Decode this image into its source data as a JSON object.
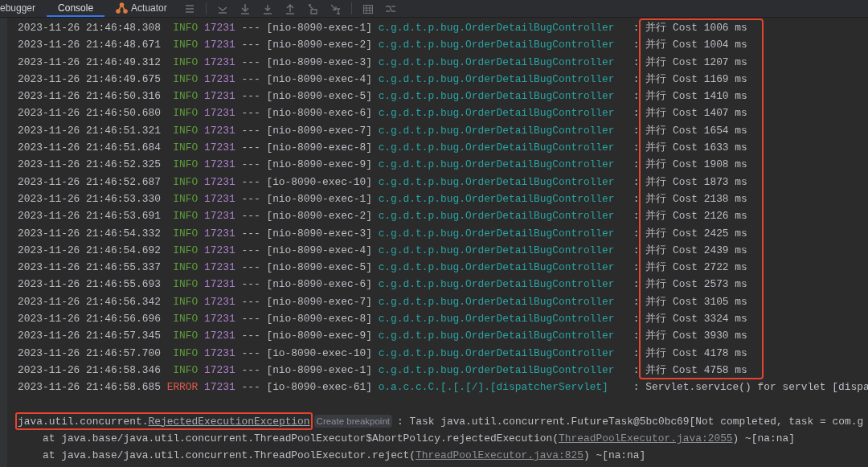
{
  "tabs": [
    {
      "label": "ebugger",
      "selected": false,
      "kind": "plain"
    },
    {
      "label": "Console",
      "selected": true,
      "kind": "plain"
    },
    {
      "label": "Actuator",
      "selected": false,
      "kind": "actuator"
    }
  ],
  "log_rows": [
    {
      "timestamp": "2023-11-26 21:46:48.308",
      "severity": "INFO",
      "pid": "17231",
      "separator": "---",
      "thread": "[nio-8090-exec-1]",
      "logger": "c.g.d.t.p.bug.OrderDetailBugController",
      "colon": ":",
      "message": "并行 Cost 1006 ms",
      "highlighted": true
    },
    {
      "timestamp": "2023-11-26 21:46:48.671",
      "severity": "INFO",
      "pid": "17231",
      "separator": "---",
      "thread": "[nio-8090-exec-2]",
      "logger": "c.g.d.t.p.bug.OrderDetailBugController",
      "colon": ":",
      "message": "并行 Cost 1004 ms",
      "highlighted": true
    },
    {
      "timestamp": "2023-11-26 21:46:49.312",
      "severity": "INFO",
      "pid": "17231",
      "separator": "---",
      "thread": "[nio-8090-exec-3]",
      "logger": "c.g.d.t.p.bug.OrderDetailBugController",
      "colon": ":",
      "message": "并行 Cost 1207 ms",
      "highlighted": true
    },
    {
      "timestamp": "2023-11-26 21:46:49.675",
      "severity": "INFO",
      "pid": "17231",
      "separator": "---",
      "thread": "[nio-8090-exec-4]",
      "logger": "c.g.d.t.p.bug.OrderDetailBugController",
      "colon": ":",
      "message": "并行 Cost 1169 ms",
      "highlighted": true
    },
    {
      "timestamp": "2023-11-26 21:46:50.316",
      "severity": "INFO",
      "pid": "17231",
      "separator": "---",
      "thread": "[nio-8090-exec-5]",
      "logger": "c.g.d.t.p.bug.OrderDetailBugController",
      "colon": ":",
      "message": "并行 Cost 1410 ms",
      "highlighted": true
    },
    {
      "timestamp": "2023-11-26 21:46:50.680",
      "severity": "INFO",
      "pid": "17231",
      "separator": "---",
      "thread": "[nio-8090-exec-6]",
      "logger": "c.g.d.t.p.bug.OrderDetailBugController",
      "colon": ":",
      "message": "并行 Cost 1407 ms",
      "highlighted": true
    },
    {
      "timestamp": "2023-11-26 21:46:51.321",
      "severity": "INFO",
      "pid": "17231",
      "separator": "---",
      "thread": "[nio-8090-exec-7]",
      "logger": "c.g.d.t.p.bug.OrderDetailBugController",
      "colon": ":",
      "message": "并行 Cost 1654 ms",
      "highlighted": true
    },
    {
      "timestamp": "2023-11-26 21:46:51.684",
      "severity": "INFO",
      "pid": "17231",
      "separator": "---",
      "thread": "[nio-8090-exec-8]",
      "logger": "c.g.d.t.p.bug.OrderDetailBugController",
      "colon": ":",
      "message": "并行 Cost 1633 ms",
      "highlighted": true
    },
    {
      "timestamp": "2023-11-26 21:46:52.325",
      "severity": "INFO",
      "pid": "17231",
      "separator": "---",
      "thread": "[nio-8090-exec-9]",
      "logger": "c.g.d.t.p.bug.OrderDetailBugController",
      "colon": ":",
      "message": "并行 Cost 1908 ms",
      "highlighted": true
    },
    {
      "timestamp": "2023-11-26 21:46:52.687",
      "severity": "INFO",
      "pid": "17231",
      "separator": "---",
      "thread": "[io-8090-exec-10]",
      "logger": "c.g.d.t.p.bug.OrderDetailBugController",
      "colon": ":",
      "message": "并行 Cost 1873 ms",
      "highlighted": true
    },
    {
      "timestamp": "2023-11-26 21:46:53.330",
      "severity": "INFO",
      "pid": "17231",
      "separator": "---",
      "thread": "[nio-8090-exec-1]",
      "logger": "c.g.d.t.p.bug.OrderDetailBugController",
      "colon": ":",
      "message": "并行 Cost 2138 ms",
      "highlighted": true
    },
    {
      "timestamp": "2023-11-26 21:46:53.691",
      "severity": "INFO",
      "pid": "17231",
      "separator": "---",
      "thread": "[nio-8090-exec-2]",
      "logger": "c.g.d.t.p.bug.OrderDetailBugController",
      "colon": ":",
      "message": "并行 Cost 2126 ms",
      "highlighted": true
    },
    {
      "timestamp": "2023-11-26 21:46:54.332",
      "severity": "INFO",
      "pid": "17231",
      "separator": "---",
      "thread": "[nio-8090-exec-3]",
      "logger": "c.g.d.t.p.bug.OrderDetailBugController",
      "colon": ":",
      "message": "并行 Cost 2425 ms",
      "highlighted": true
    },
    {
      "timestamp": "2023-11-26 21:46:54.692",
      "severity": "INFO",
      "pid": "17231",
      "separator": "---",
      "thread": "[nio-8090-exec-4]",
      "logger": "c.g.d.t.p.bug.OrderDetailBugController",
      "colon": ":",
      "message": "并行 Cost 2439 ms",
      "highlighted": true
    },
    {
      "timestamp": "2023-11-26 21:46:55.337",
      "severity": "INFO",
      "pid": "17231",
      "separator": "---",
      "thread": "[nio-8090-exec-5]",
      "logger": "c.g.d.t.p.bug.OrderDetailBugController",
      "colon": ":",
      "message": "并行 Cost 2722 ms",
      "highlighted": true
    },
    {
      "timestamp": "2023-11-26 21:46:55.693",
      "severity": "INFO",
      "pid": "17231",
      "separator": "---",
      "thread": "[nio-8090-exec-6]",
      "logger": "c.g.d.t.p.bug.OrderDetailBugController",
      "colon": ":",
      "message": "并行 Cost 2573 ms",
      "highlighted": true
    },
    {
      "timestamp": "2023-11-26 21:46:56.342",
      "severity": "INFO",
      "pid": "17231",
      "separator": "---",
      "thread": "[nio-8090-exec-7]",
      "logger": "c.g.d.t.p.bug.OrderDetailBugController",
      "colon": ":",
      "message": "并行 Cost 3105 ms",
      "highlighted": true
    },
    {
      "timestamp": "2023-11-26 21:46:56.696",
      "severity": "INFO",
      "pid": "17231",
      "separator": "---",
      "thread": "[nio-8090-exec-8]",
      "logger": "c.g.d.t.p.bug.OrderDetailBugController",
      "colon": ":",
      "message": "并行 Cost 3324 ms",
      "highlighted": true
    },
    {
      "timestamp": "2023-11-26 21:46:57.345",
      "severity": "INFO",
      "pid": "17231",
      "separator": "---",
      "thread": "[nio-8090-exec-9]",
      "logger": "c.g.d.t.p.bug.OrderDetailBugController",
      "colon": ":",
      "message": "并行 Cost 3930 ms",
      "highlighted": true
    },
    {
      "timestamp": "2023-11-26 21:46:57.700",
      "severity": "INFO",
      "pid": "17231",
      "separator": "---",
      "thread": "[io-8090-exec-10]",
      "logger": "c.g.d.t.p.bug.OrderDetailBugController",
      "colon": ":",
      "message": "并行 Cost 4178 ms",
      "highlighted": true
    },
    {
      "timestamp": "2023-11-26 21:46:58.346",
      "severity": "INFO",
      "pid": "17231",
      "separator": "---",
      "thread": "[nio-8090-exec-1]",
      "logger": "c.g.d.t.p.bug.OrderDetailBugController",
      "colon": ":",
      "message": "并行 Cost 4758 ms",
      "highlighted": true
    },
    {
      "timestamp": "2023-11-26 21:46:58.685",
      "severity": "ERROR",
      "pid": "17231",
      "separator": "---",
      "thread": "[io-8090-exec-61]",
      "logger": "o.a.c.c.C.[.[.[/].[dispatcherServlet]",
      "colon": ":",
      "message": "Servlet.service() for servlet [dispa",
      "highlighted": false
    }
  ],
  "exception": {
    "package": "java.util.concurrent.",
    "class_link": "RejectedExecutionException",
    "breakpoint_hint": "Create breakpoint",
    "message": ": Task java.util.concurrent.FutureTask@5bc0bc69[Not completed, task = com.g",
    "highlighted": true
  },
  "stack_trace": [
    {
      "prefix": "at java.base/java.util.concurrent.ThreadPoolExecutor$AbortPolicy.rejectedExecution(",
      "source_link": "ThreadPoolExecutor.java:2055",
      "suffix": ") ~[na:na]"
    },
    {
      "prefix": "at java.base/java.util.concurrent.ThreadPoolExecutor.reject(",
      "source_link": "ThreadPoolExecutor.java:825",
      "suffix": ") ~[na:na]"
    }
  ]
}
